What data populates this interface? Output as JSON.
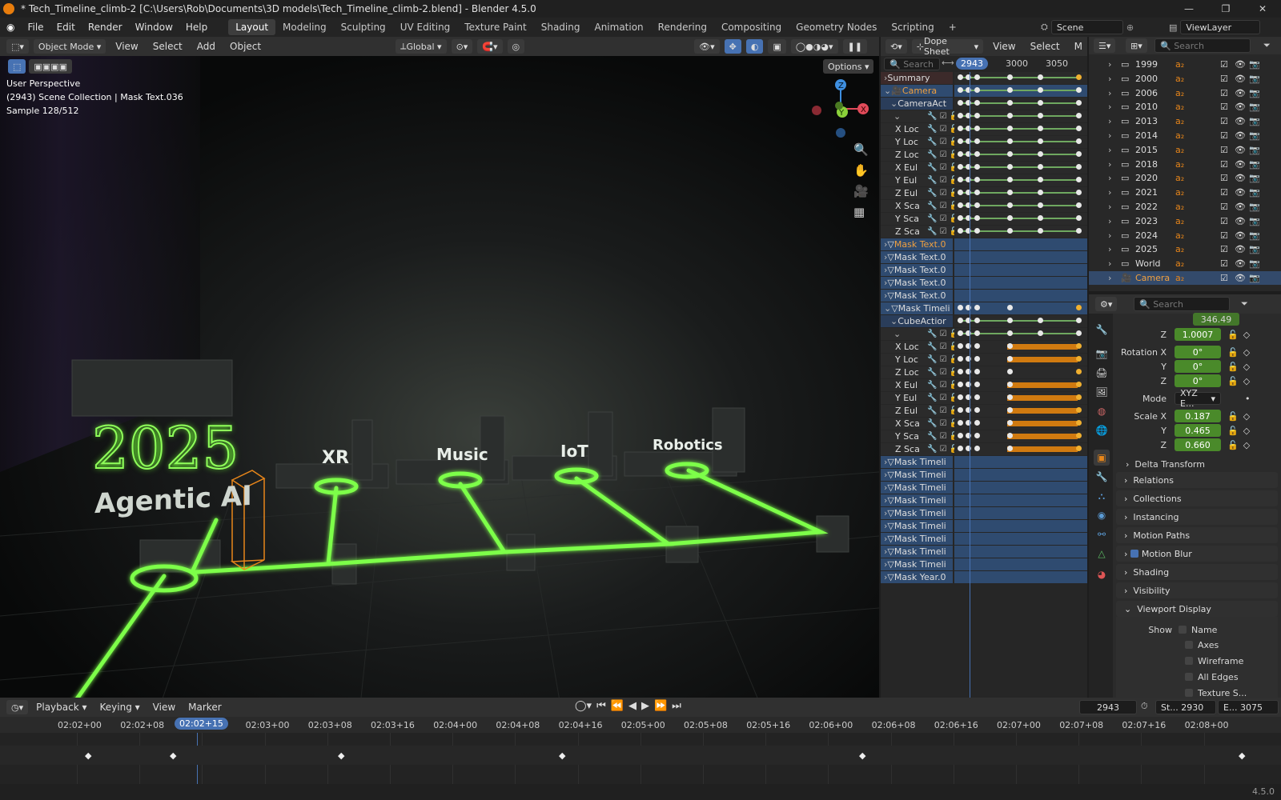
{
  "window": {
    "title": "* Tech_Timeline_climb-2 [C:\\Users\\Rob\\Documents\\3D models\\Tech_Timeline_climb-2.blend] - Blender 4.5.0"
  },
  "menu": [
    "File",
    "Edit",
    "Render",
    "Window",
    "Help"
  ],
  "workspaces": [
    "Layout",
    "Modeling",
    "Sculpting",
    "UV Editing",
    "Texture Paint",
    "Shading",
    "Animation",
    "Rendering",
    "Compositing",
    "Geometry Nodes",
    "Scripting"
  ],
  "active_workspace": "Layout",
  "scene_name": "Scene",
  "view_layer": "ViewLayer",
  "viewport": {
    "mode": "Object Mode",
    "menus": [
      "View",
      "Select",
      "Add",
      "Object"
    ],
    "transform": "Global",
    "options_label": "Options",
    "overlay_lines": [
      "User Perspective",
      "(2943) Scene Collection | Mask Text.036",
      "Sample 128/512"
    ],
    "scene_text": {
      "year": "2025",
      "title": "Agentic AI",
      "labels": [
        "XR",
        "Music",
        "IoT",
        "Robotics"
      ]
    },
    "gizmo_axes": [
      "X",
      "Y",
      "Z"
    ],
    "glow_color": "#7dff4a",
    "select_color": "#e8861a"
  },
  "dope_sheet": {
    "editor": "Dope Sheet",
    "menus": [
      "View",
      "Select",
      "M"
    ],
    "search_placeholder": "Search",
    "current_frame": "2943",
    "frame_labels": [
      "3000",
      "3050"
    ],
    "channels": [
      {
        "name": "Summary",
        "kind": "summary"
      },
      {
        "name": "Camera",
        "kind": "object"
      },
      {
        "name": "CameraAct",
        "kind": "action"
      },
      {
        "name": "",
        "kind": "group"
      },
      {
        "name": "X Loc",
        "kind": "fcurve"
      },
      {
        "name": "Y Loc",
        "kind": "fcurve"
      },
      {
        "name": "Z Loc",
        "kind": "fcurve"
      },
      {
        "name": "X Eul",
        "kind": "fcurve"
      },
      {
        "name": "Y Eul",
        "kind": "fcurve"
      },
      {
        "name": "Z Eul",
        "kind": "fcurve"
      },
      {
        "name": "X Sca",
        "kind": "fcurve"
      },
      {
        "name": "Y Sca",
        "kind": "fcurve"
      },
      {
        "name": "Z Sca",
        "kind": "fcurve"
      },
      {
        "name": "Mask Text.0",
        "kind": "object-orange"
      },
      {
        "name": "Mask Text.0",
        "kind": "object"
      },
      {
        "name": "Mask Text.0",
        "kind": "object"
      },
      {
        "name": "Mask Text.0",
        "kind": "object"
      },
      {
        "name": "Mask Text.0",
        "kind": "object"
      },
      {
        "name": "Mask Timeli",
        "kind": "object"
      },
      {
        "name": "CubeActior",
        "kind": "action"
      },
      {
        "name": "",
        "kind": "group"
      },
      {
        "name": "X Loc",
        "kind": "fcurve2"
      },
      {
        "name": "Y Loc",
        "kind": "fcurve2"
      },
      {
        "name": "Z Loc",
        "kind": "fcurve2"
      },
      {
        "name": "X Eul",
        "kind": "fcurve2"
      },
      {
        "name": "Y Eul",
        "kind": "fcurve2"
      },
      {
        "name": "Z Eul",
        "kind": "fcurve2"
      },
      {
        "name": "X Sca",
        "kind": "fcurve2"
      },
      {
        "name": "Y Sca",
        "kind": "fcurve2"
      },
      {
        "name": "Z Sca",
        "kind": "fcurve2"
      },
      {
        "name": "Mask Timeli",
        "kind": "object"
      },
      {
        "name": "Mask Timeli",
        "kind": "object"
      },
      {
        "name": "Mask Timeli",
        "kind": "object"
      },
      {
        "name": "Mask Timeli",
        "kind": "object"
      },
      {
        "name": "Mask Timeli",
        "kind": "object"
      },
      {
        "name": "Mask Timeli",
        "kind": "object"
      },
      {
        "name": "Mask Timeli",
        "kind": "object"
      },
      {
        "name": "Mask Timeli",
        "kind": "object"
      },
      {
        "name": "Mask Timeli",
        "kind": "object"
      },
      {
        "name": "Mask Year.0",
        "kind": "object"
      }
    ]
  },
  "outliner": {
    "search_placeholder": "Search",
    "rows": [
      "1999",
      "2000",
      "2006",
      "2010",
      "2013",
      "2014",
      "2015",
      "2018",
      "2020",
      "2021",
      "2022",
      "2023",
      "2024",
      "2025",
      "World",
      "Camera"
    ]
  },
  "properties": {
    "search_placeholder": "Search",
    "location_z": "1.0007",
    "location_y_partial": "346.49",
    "rotation_label": "Rotation X",
    "rotation": [
      "0°",
      "0°",
      "0°"
    ],
    "mode_label": "Mode",
    "mode_value": "XYZ E...",
    "scale_label": "Scale X",
    "scale": [
      "0.187",
      "0.465",
      "0.660"
    ],
    "axis_labels": [
      "Y",
      "Z"
    ],
    "panels": [
      "Delta Transform",
      "Relations",
      "Collections",
      "Instancing",
      "Motion Paths",
      "Motion Blur",
      "Shading",
      "Visibility",
      "Viewport Display"
    ],
    "show_label": "Show",
    "show_options": [
      "Name",
      "Axes",
      "Wireframe",
      "All Edges",
      "Texture S..."
    ]
  },
  "timeline": {
    "menus": [
      "Playback",
      "Keying",
      "View",
      "Marker"
    ],
    "current_frame": "2943",
    "start_label": "St...",
    "start": "2930",
    "end_label": "E...",
    "end": "3075",
    "current_time": "02:02+15",
    "ticks": [
      "02:02+00",
      "02:02+08",
      "02:02+15",
      "02:03+00",
      "02:03+08",
      "02:03+16",
      "02:04+00",
      "02:04+08",
      "02:04+16",
      "02:05+00",
      "02:05+08",
      "02:05+16",
      "02:06+00",
      "02:06+08",
      "02:06+16",
      "02:07+00",
      "02:07+08",
      "02:07+16",
      "02:08+00"
    ]
  },
  "version": "4.5.0"
}
